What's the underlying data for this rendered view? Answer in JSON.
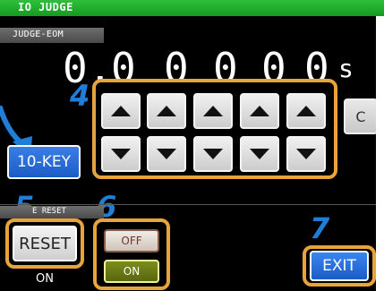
{
  "window": {
    "title": "IO JUDGE"
  },
  "section_tab": {
    "label": "JUDGE-EOM"
  },
  "display": {
    "digits": [
      "0",
      ".",
      "0",
      "0",
      "0",
      "0",
      "0"
    ],
    "unit": "s"
  },
  "stepper": {
    "up_icon": "triangle-up",
    "down_icon": "triangle-down",
    "clear_label": "C"
  },
  "tenkey": {
    "label": "10-KEY"
  },
  "reset_section": {
    "label": "E RESET"
  },
  "reset": {
    "label": "RESET",
    "state_label": "ON"
  },
  "toggle": {
    "off_label": "OFF",
    "on_label": "ON",
    "selected": "ON"
  },
  "exit": {
    "label": "EXIT"
  },
  "callouts": {
    "n4": "4",
    "n5": "5",
    "n6": "6",
    "n7": "7"
  },
  "colors": {
    "accent": "#e8a339",
    "callout": "#1f7fd8",
    "titlebar": "#1fae2c",
    "selected": "#66771a"
  }
}
